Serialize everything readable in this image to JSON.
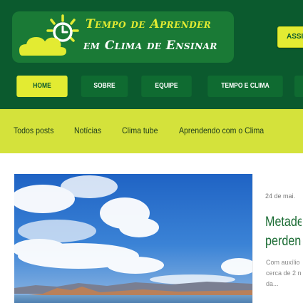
{
  "colors": {
    "header_bg": "#0b5a2e",
    "nav_bg": "#0f6b31",
    "accent_yellow": "#e3eb32",
    "catbar_bg": "#d4e23b",
    "title_green": "#1a6b33"
  },
  "logo": {
    "title": "Tempo de Aprender",
    "subtitle": "em Clima de Ensinar",
    "icon": "sun-cloud-clock-icon"
  },
  "header": {
    "subscribe_label": "ASSI"
  },
  "nav": {
    "items": [
      {
        "label": "HOME",
        "active": true
      },
      {
        "label": "SOBRE",
        "active": false
      },
      {
        "label": "EQUIPE",
        "active": false
      },
      {
        "label": "TEMPO E CLIMA",
        "active": false
      },
      {
        "label": "",
        "active": false
      }
    ]
  },
  "categories": {
    "items": [
      "Todos posts",
      "Notícias",
      "Clima tube",
      "Aprendendo com o Clima"
    ]
  },
  "article": {
    "date": "24 de mai.",
    "title_line1": "Metade",
    "title_line2": "perdeno",
    "excerpt_line1": "Com auxílio",
    "excerpt_line2": "cerca de 2 n",
    "excerpt_line3": "da..."
  }
}
